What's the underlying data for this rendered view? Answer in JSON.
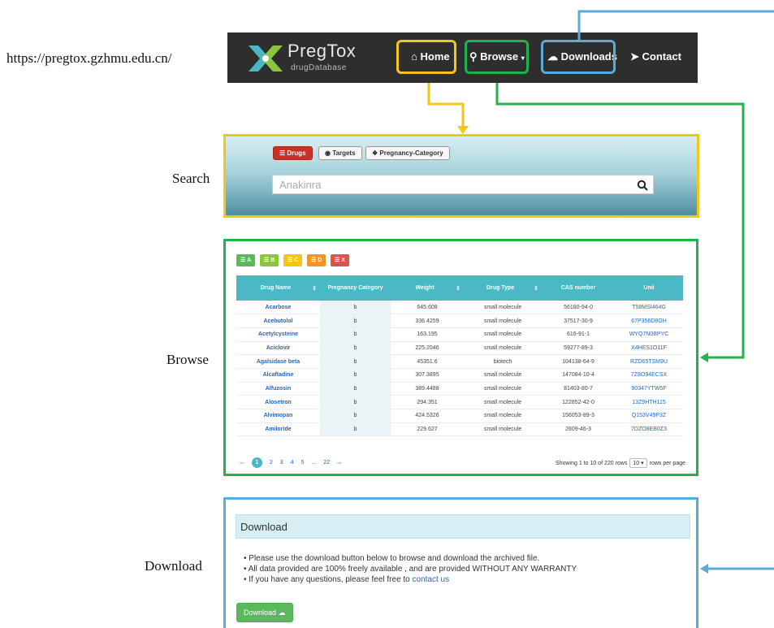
{
  "url_label": "https://pregtox.gzhmu.edu.cn/",
  "section_labels": {
    "search": "Search",
    "browse": "Browse",
    "download": "Download"
  },
  "colors": {
    "home": "#f5c518",
    "browse": "#22b14c",
    "downloads": "#5aacd8",
    "nav_bg": "#2e2e2e",
    "table_header": "#4bb8c6"
  },
  "navbar": {
    "logo_title": "PregTox",
    "logo_subtitle": "drugDatabase",
    "items": [
      {
        "label": "Home",
        "icon": "home-icon"
      },
      {
        "label": "Browse",
        "icon": "search-icon"
      },
      {
        "label": "Downloads",
        "icon": "download-cloud-icon"
      },
      {
        "label": "Contact",
        "icon": "send-icon"
      }
    ]
  },
  "search": {
    "tabs": [
      {
        "label": "Drugs",
        "icon": "list-icon"
      },
      {
        "label": "Targets",
        "icon": "target-icon"
      },
      {
        "label": "Pregnancy-Category",
        "icon": "tags-icon"
      }
    ],
    "query": "Anakinra"
  },
  "browse": {
    "categories": [
      {
        "label": "A",
        "color": "#5cb85c"
      },
      {
        "label": "B",
        "color": "#8cc63f"
      },
      {
        "label": "C",
        "color": "#f5c518"
      },
      {
        "label": "D",
        "color": "#f0952b"
      },
      {
        "label": "X",
        "color": "#d9534f"
      }
    ],
    "columns": [
      "Drug Name",
      "Pregnancy Category",
      "Weight",
      "Drug Type",
      "CAS number",
      "Unii"
    ],
    "rows": [
      [
        "Acarbose",
        "b",
        "645.608",
        "small molecule",
        "56180-94-0",
        "T58MSI464G"
      ],
      [
        "Acebutolol",
        "b",
        "336.4259",
        "small molecule",
        "37517-30-9",
        "67P356D8GH"
      ],
      [
        "Acetylcysteine",
        "b",
        "163.195",
        "small molecule",
        "616-91-1",
        "WYQ7N0BPYC"
      ],
      [
        "Aciclovir",
        "b",
        "225.2046",
        "small molecule",
        "59277-89-3",
        "X4HES1O11F"
      ],
      [
        "Agalsidase beta",
        "b",
        "45351.6",
        "biotech",
        "104138-64-9",
        "RZD65TSM9U"
      ],
      [
        "Alcaftadine",
        "b",
        "307.3895",
        "small molecule",
        "147084-10-4",
        "7Z8O94ECSX"
      ],
      [
        "Alfuzosin",
        "b",
        "389.4488",
        "small molecule",
        "81403-80-7",
        "90347YTW5F"
      ],
      [
        "Alosetron",
        "b",
        "294.351",
        "small molecule",
        "122852-42-0",
        "13Z9HTH115"
      ],
      [
        "Alvimopan",
        "b",
        "424.5326",
        "small molecule",
        "156053-89-3",
        "Q153V49P3Z"
      ],
      [
        "Amiloride",
        "b",
        "229.627",
        "small molecule",
        "2609-46-3",
        "7DZO8EB0Z3"
      ]
    ],
    "pagination": {
      "pages": [
        "1",
        "2",
        "3",
        "4",
        "5",
        "...",
        "22"
      ],
      "showing": "Showing 1 to 10 of 220 rows",
      "rows_per_page_value": "10",
      "rows_per_page_label": "rows per page"
    }
  },
  "download": {
    "title": "Download",
    "bullets": [
      "Please use the download button below to browse and download the archived file.",
      "All data provided are 100% freely available , and are provided WITHOUT ANY WARRANTY",
      "If you have any questions, please feel free to"
    ],
    "contact_link": "contact us",
    "button_label": "Download"
  }
}
